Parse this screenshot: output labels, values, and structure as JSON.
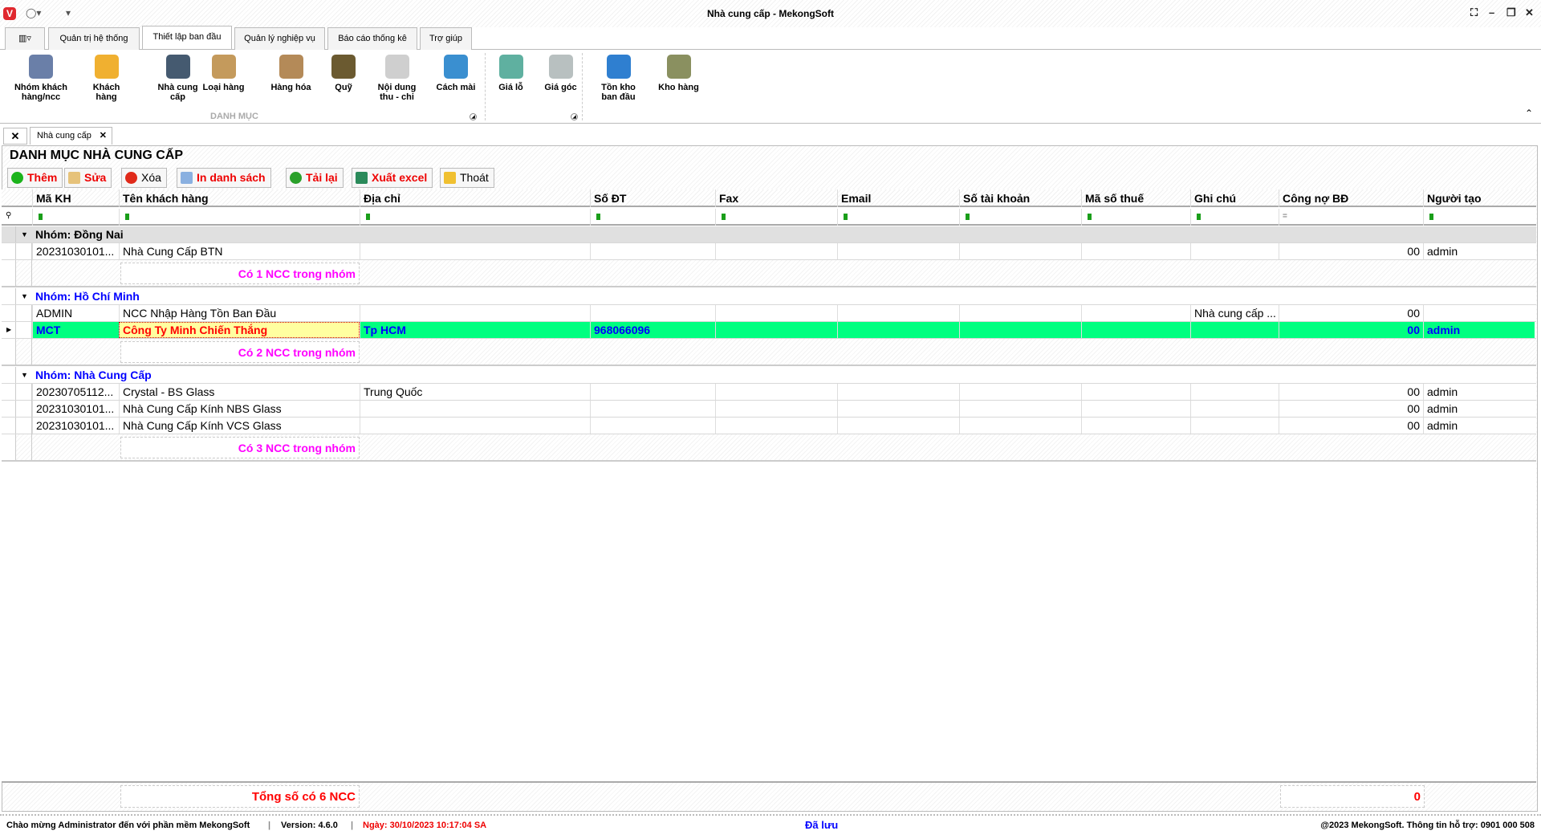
{
  "window": {
    "title": "Nhà cung cấp - MekongSoft",
    "logo": "V"
  },
  "ribbon_tabs": [
    "Quản trị hệ thống",
    "Thiết lập ban đầu",
    "Quản lý nghiệp vụ",
    "Báo cáo thống kê",
    "Trợ giúp"
  ],
  "ribbon_buttons": [
    {
      "l1": "Nhóm khách",
      "l2": "hàng/ncc",
      "color": "#6a7fa8"
    },
    {
      "l1": "Khách",
      "l2": "hàng",
      "color": "#f0b030"
    },
    {
      "l1": "Nhà cung",
      "l2": "cấp",
      "color": "#455a70"
    },
    {
      "l1": "Loại hàng",
      "l2": "",
      "color": "#c49a5c"
    },
    {
      "l1": "Hàng hóa",
      "l2": "",
      "color": "#b48a58"
    },
    {
      "l1": "Quỹ",
      "l2": "",
      "color": "#6b5a30"
    },
    {
      "l1": "Nội dung",
      "l2": "thu - chi",
      "color": "#cfcfcf"
    },
    {
      "l1": "Cách mài",
      "l2": "",
      "color": "#3a8fd0"
    },
    {
      "l1": "Giá lỗ",
      "l2": "",
      "color": "#5fb0a0"
    },
    {
      "l1": "Giá góc",
      "l2": "",
      "color": "#b8c0c0"
    },
    {
      "l1": "Tồn kho",
      "l2": "ban đầu",
      "color": "#2f7fd0"
    },
    {
      "l1": "Kho hàng",
      "l2": "",
      "color": "#8a9060"
    }
  ],
  "ribbon_group": "DANH MỤC",
  "doc_tab": "Nhà cung cấp",
  "page_title": "DANH MỤC NHÀ CUNG CẤP",
  "toolbar": {
    "add": "Thêm",
    "edit": "Sửa",
    "delete": "Xóa",
    "print": "In danh sách",
    "reload": "Tải lại",
    "excel": "Xuất excel",
    "exit": "Thoát"
  },
  "columns": [
    "Mã KH",
    "Tên khách hàng",
    "Địa chỉ",
    "Số ĐT",
    "Fax",
    "Email",
    "Số tài khoản",
    "Mã số thuế",
    "Ghi chú",
    "Công nợ BĐ",
    "Người tạo"
  ],
  "groups": [
    {
      "title": "Nhóm: Đồng Nai",
      "summary": "Có 1 NCC trong nhóm",
      "rows": [
        [
          "20231030101...",
          "Nhà Cung Cấp BTN",
          "",
          "",
          "",
          "",
          "",
          "",
          "",
          "00",
          "admin"
        ]
      ]
    },
    {
      "title": "Nhóm: Hồ Chí Minh",
      "summary": "Có 2 NCC trong nhóm",
      "rows": [
        [
          "ADMIN",
          "NCC Nhập Hàng Tồn Ban Đầu",
          "",
          "",
          "",
          "",
          "",
          "",
          "Nhà cung cấp ...",
          "00",
          ""
        ],
        [
          "MCT",
          "Công Ty Minh Chiến Thắng",
          "Tp HCM",
          "968066096",
          "",
          "",
          "",
          "",
          "",
          "00",
          "admin"
        ]
      ]
    },
    {
      "title": "Nhóm: Nhà Cung Cấp",
      "summary": "Có 3 NCC trong nhóm",
      "rows": [
        [
          "20230705112...",
          "Crystal - BS Glass",
          "Trung Quốc",
          "",
          "",
          "",
          "",
          "",
          "",
          "00",
          "admin"
        ],
        [
          "20231030101...",
          "Nhà Cung Cấp Kính NBS Glass",
          "",
          "",
          "",
          "",
          "",
          "",
          "",
          "00",
          "admin"
        ],
        [
          "20231030101...",
          "Nhà Cung Cấp Kính VCS Glass",
          "",
          "",
          "",
          "",
          "",
          "",
          "",
          "00",
          "admin"
        ]
      ]
    }
  ],
  "footer": {
    "total_label": "Tổng số có 6 NCC",
    "total_debt": "0"
  },
  "status": {
    "welcome": "Chào mừng Administrator đến với phần mềm MekongSoft",
    "version": "Version: 4.6.0",
    "date": "Ngày: 30/10/2023 10:17:04 SA",
    "saved": "Đã lưu",
    "support": "@2023 MekongSoft. Thông tin hỗ trợ: 0901 000 508"
  },
  "colors": {
    "selected_row": "#00ff80",
    "summary": "#ff00ff",
    "total": "#ff0000",
    "link_blue": "#0000ff"
  }
}
